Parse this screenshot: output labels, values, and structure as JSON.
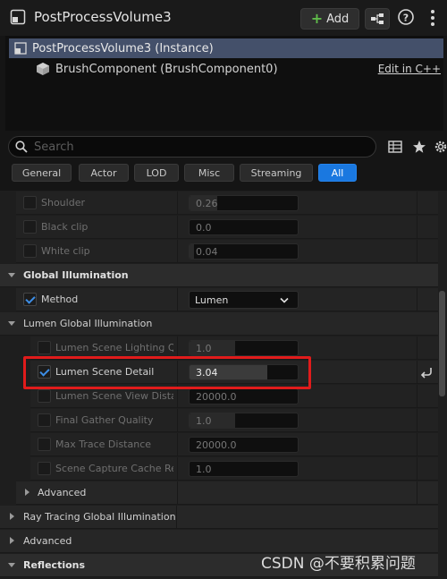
{
  "window": {
    "title": "PostProcessVolume3",
    "add_label": "Add"
  },
  "tree": {
    "instance_label": "PostProcessVolume3 (Instance)",
    "component_label": "BrushComponent (BrushComponent0)",
    "edit_link": "Edit in C++"
  },
  "search": {
    "placeholder": "Search"
  },
  "tabs": [
    "General",
    "Actor",
    "LOD",
    "Misc",
    "Streaming",
    "All"
  ],
  "active_tab": "All",
  "rows": {
    "shoulder": {
      "label": "Shoulder",
      "value": "0.26"
    },
    "black_clip": {
      "label": "Black clip",
      "value": "0.0"
    },
    "white_clip": {
      "label": "White clip",
      "value": "0.04"
    },
    "gi_section": "Global Illumination",
    "method": {
      "label": "Method",
      "value": "Lumen"
    },
    "lumen_gi_section": "Lumen Global Illumination",
    "scene_lighting": {
      "label": "Lumen Scene Lighting Q...",
      "value": "1.0"
    },
    "scene_detail": {
      "label": "Lumen Scene Detail",
      "value": "3.04",
      "fill_fraction": 0.72
    },
    "view_distance": {
      "label": "Lumen Scene View Dista...",
      "value": "20000.0"
    },
    "final_gather": {
      "label": "Final Gather Quality",
      "value": "1.0"
    },
    "max_trace": {
      "label": "Max Trace Distance",
      "value": "20000.0"
    },
    "capture_cache": {
      "label": "Scene Capture Cache Re...",
      "value": "1.0"
    },
    "advanced_sub": "Advanced",
    "ray_tracing_gi": "Ray Tracing Global Illumination",
    "advanced": "Advanced",
    "reflections": "Reflections"
  },
  "watermark": "CSDN @不要积累问题",
  "colors": {
    "accent": "#1a78e0",
    "highlight_border": "#e01b1b",
    "add_plus": "#5fbb4a",
    "checkbox_check": "#3d8ee6"
  }
}
